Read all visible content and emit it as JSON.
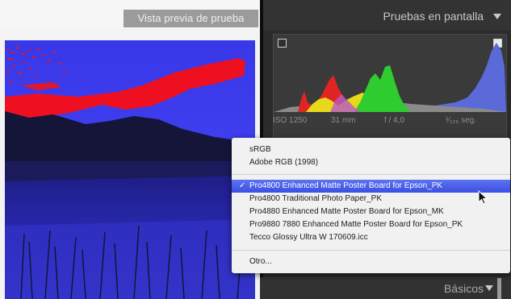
{
  "preview": {
    "label": "Vista previa de prueba"
  },
  "panel": {
    "title": "Pruebas en pantalla",
    "icons": [
      "triangle-down-icon",
      "shadow-clip-icon",
      "highlight-clip-icon"
    ]
  },
  "histogram": {
    "exif": {
      "iso": "ISO 1250",
      "focal": "31 mm",
      "aperture": "f / 4,0",
      "shutter": "¹⁄₁₂₅ seg."
    }
  },
  "menu": {
    "items": [
      {
        "label": "sRGB",
        "selected": false
      },
      {
        "label": "Adobe RGB (1998)",
        "selected": false
      },
      {
        "label": "Pro4800 Enhanced Matte Poster Board for Epson_PK",
        "selected": true
      },
      {
        "label": "Pro4800 Traditional Photo Paper_PK",
        "selected": false
      },
      {
        "label": "Pro4880 Enhanced Matte Poster Board for Epson_MK",
        "selected": false
      },
      {
        "label": "Pro9880 7880 Enhanced Matte Poster Board for Epson_PK",
        "selected": false
      },
      {
        "label": "Tecco Glossy Ultra W 170609.icc",
        "selected": false
      },
      {
        "label": "Otro...",
        "selected": false
      }
    ],
    "check": "✓"
  },
  "bottom": {
    "title": "Básicos"
  },
  "colors": {
    "selection": "#4760ea",
    "gamut_warning": "#ff0000",
    "photo_blue": "#3c3cf0"
  }
}
